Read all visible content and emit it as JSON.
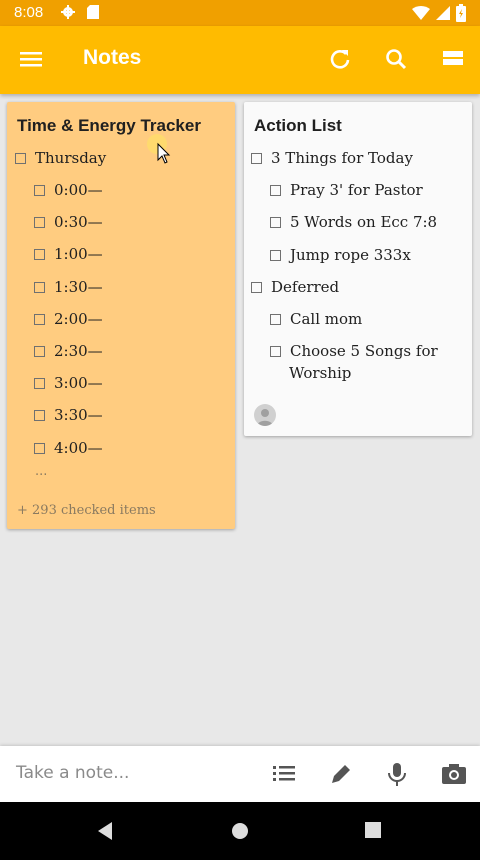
{
  "status": {
    "time": "8:08"
  },
  "appbar": {
    "title": "Notes"
  },
  "notes": [
    {
      "title": "Time & Energy Tracker",
      "color": "#ffcc80",
      "items": [
        {
          "label": "Thursday",
          "level": 0
        },
        {
          "label": "0:00—",
          "level": 1
        },
        {
          "label": "0:30—",
          "level": 1
        },
        {
          "label": "1:00—",
          "level": 1
        },
        {
          "label": "1:30—",
          "level": 1
        },
        {
          "label": "2:00—",
          "level": 1
        },
        {
          "label": "2:30—",
          "level": 1
        },
        {
          "label": "3:00—",
          "level": 1
        },
        {
          "label": "3:30—",
          "level": 1
        },
        {
          "label": "4:00—",
          "level": 1
        }
      ],
      "more": "...",
      "checked_summary": "+ 293 checked items"
    },
    {
      "title": "Action List",
      "color": "#fafafa",
      "items": [
        {
          "label": "3 Things for Today",
          "level": 0
        },
        {
          "label": "Pray 3' for Pastor",
          "level": 1
        },
        {
          "label": "5 Words on Ecc 7:8",
          "level": 1
        },
        {
          "label": "Jump rope 333x",
          "level": 1
        },
        {
          "label": "Deferred",
          "level": 0
        },
        {
          "label": "Call mom",
          "level": 1
        },
        {
          "label": "Choose 5 Songs for",
          "level": 1
        },
        {
          "label": "Worship",
          "level": 1
        }
      ]
    }
  ],
  "bottom": {
    "placeholder": "Take a note..."
  },
  "icons": {
    "menu": "hamburger-menu-icon",
    "refresh": "refresh-icon",
    "search": "search-icon",
    "view": "view-toggle-icon",
    "list": "checklist-icon",
    "draw": "pen-icon",
    "mic": "microphone-icon",
    "camera": "camera-icon"
  },
  "colors": {
    "statusbar": "#f0a000",
    "appbar": "#ffbb00",
    "accent": "#ffffff"
  }
}
